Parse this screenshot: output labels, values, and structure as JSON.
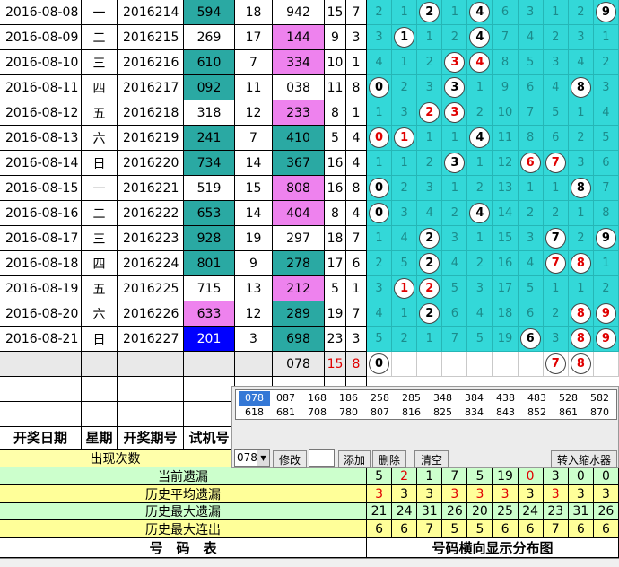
{
  "rows": [
    {
      "date": "2016-08-08",
      "week": "一",
      "issue": "2016214",
      "draw": "594",
      "draw_style": "teal",
      "sum": "18",
      "test": "942",
      "test_style": "white",
      "span": "15",
      "tail": "7",
      "dist": [
        "2",
        "1",
        "*2",
        "1",
        "*4",
        "6",
        "3",
        "1",
        "2",
        "*9"
      ]
    },
    {
      "date": "2016-08-09",
      "week": "二",
      "issue": "2016215",
      "draw": "269",
      "draw_style": "white",
      "sum": "17",
      "test": "144",
      "test_style": "pink",
      "span": "9",
      "tail": "3",
      "dist": [
        "3",
        "*1",
        "1",
        "2",
        "*4",
        "7",
        "4",
        "2",
        "3",
        "1"
      ]
    },
    {
      "date": "2016-08-10",
      "week": "三",
      "issue": "2016216",
      "draw": "610",
      "draw_style": "teal",
      "sum": "7",
      "test": "334",
      "test_style": "pink",
      "span": "10",
      "tail": "1",
      "dist": [
        "4",
        "1",
        "2",
        "r3",
        "r4",
        "8",
        "5",
        "3",
        "4",
        "2"
      ]
    },
    {
      "date": "2016-08-11",
      "week": "四",
      "issue": "2016217",
      "draw": "092",
      "draw_style": "teal",
      "sum": "11",
      "test": "038",
      "test_style": "white",
      "span": "11",
      "tail": "8",
      "dist": [
        "*0",
        "2",
        "3",
        "*3",
        "1",
        "9",
        "6",
        "4",
        "*8",
        "3"
      ]
    },
    {
      "date": "2016-08-12",
      "week": "五",
      "issue": "2016218",
      "draw": "318",
      "draw_style": "white",
      "sum": "12",
      "test": "233",
      "test_style": "pink",
      "span": "8",
      "tail": "1",
      "dist": [
        "1",
        "3",
        "r2",
        "r3",
        "2",
        "10",
        "7",
        "5",
        "1",
        "4"
      ]
    },
    {
      "date": "2016-08-13",
      "week": "六",
      "issue": "2016219",
      "draw": "241",
      "draw_style": "teal",
      "sum": "7",
      "test": "410",
      "test_style": "teal",
      "span": "5",
      "tail": "4",
      "dist": [
        "r0",
        "r1",
        "1",
        "1",
        "*4",
        "11",
        "8",
        "6",
        "2",
        "5"
      ]
    },
    {
      "date": "2016-08-14",
      "week": "日",
      "issue": "2016220",
      "draw": "734",
      "draw_style": "teal",
      "sum": "14",
      "test": "367",
      "test_style": "teal",
      "span": "16",
      "tail": "4",
      "dist": [
        "1",
        "1",
        "2",
        "*3",
        "1",
        "12",
        "r6",
        "r7",
        "3",
        "6"
      ]
    },
    {
      "date": "2016-08-15",
      "week": "一",
      "issue": "2016221",
      "draw": "519",
      "draw_style": "white",
      "sum": "15",
      "test": "808",
      "test_style": "pink",
      "span": "16",
      "tail": "8",
      "dist": [
        "*0",
        "2",
        "3",
        "1",
        "2",
        "13",
        "1",
        "1",
        "*8",
        "7"
      ]
    },
    {
      "date": "2016-08-16",
      "week": "二",
      "issue": "2016222",
      "draw": "653",
      "draw_style": "teal",
      "sum": "14",
      "test": "404",
      "test_style": "pink",
      "span": "8",
      "tail": "4",
      "dist": [
        "*0",
        "3",
        "4",
        "2",
        "*4",
        "14",
        "2",
        "2",
        "1",
        "8"
      ]
    },
    {
      "date": "2016-08-17",
      "week": "三",
      "issue": "2016223",
      "draw": "928",
      "draw_style": "teal",
      "sum": "19",
      "test": "297",
      "test_style": "white",
      "span": "18",
      "tail": "7",
      "dist": [
        "1",
        "4",
        "*2",
        "3",
        "1",
        "15",
        "3",
        "*7",
        "2",
        "*9"
      ]
    },
    {
      "date": "2016-08-18",
      "week": "四",
      "issue": "2016224",
      "draw": "801",
      "draw_style": "teal",
      "sum": "9",
      "test": "278",
      "test_style": "teal",
      "span": "17",
      "tail": "6",
      "dist": [
        "2",
        "5",
        "*2",
        "4",
        "2",
        "16",
        "4",
        "r7",
        "r8",
        "1"
      ]
    },
    {
      "date": "2016-08-19",
      "week": "五",
      "issue": "2016225",
      "draw": "715",
      "draw_style": "white",
      "sum": "13",
      "test": "212",
      "test_style": "pink",
      "span": "5",
      "tail": "1",
      "dist": [
        "3",
        "r1",
        "r2",
        "5",
        "3",
        "17",
        "5",
        "1",
        "1",
        "2"
      ]
    },
    {
      "date": "2016-08-20",
      "week": "六",
      "issue": "2016226",
      "draw": "633",
      "draw_style": "pink",
      "sum": "12",
      "test": "289",
      "test_style": "teal",
      "span": "19",
      "tail": "7",
      "dist": [
        "4",
        "1",
        "*2",
        "6",
        "4",
        "18",
        "6",
        "2",
        "r8",
        "r9"
      ]
    },
    {
      "date": "2016-08-21",
      "week": "日",
      "issue": "2016227",
      "draw": "201",
      "draw_style": "blue",
      "sum": "3",
      "test": "698",
      "test_style": "teal",
      "span": "23",
      "tail": "3",
      "dist": [
        "5",
        "2",
        "1",
        "7",
        "5",
        "19",
        "*6",
        "3",
        "r8",
        "r9"
      ]
    }
  ],
  "pending_row": {
    "test": "078",
    "span": "15",
    "tail": "8",
    "dist": [
      "*0",
      "",
      "",
      "",
      "",
      "",
      "",
      "r7",
      "r8",
      ""
    ]
  },
  "header": {
    "date": "开奖日期",
    "week": "星期",
    "issue": "开奖期号",
    "test": "试机号"
  },
  "combo_items": [
    "078",
    "087",
    "168",
    "186",
    "258",
    "285",
    "348",
    "384",
    "438",
    "483",
    "528",
    "582",
    "618",
    "681",
    "708",
    "780",
    "807",
    "816",
    "825",
    "834",
    "843",
    "852",
    "861",
    "870"
  ],
  "toolbar": {
    "select_value": "078",
    "modify": "修改",
    "add": "添加",
    "delete": "删除",
    "clear": "清空",
    "transfer": "转入缩水器"
  },
  "stats": {
    "occurrences_label": "出现次数",
    "current_miss_label": "当前遗漏",
    "current_miss": [
      "5",
      "2",
      "1",
      "7",
      "5",
      "19",
      "0",
      "3",
      "0",
      "0"
    ],
    "avg_miss_label": "历史平均遗漏",
    "avg_miss": [
      "3",
      "3",
      "3",
      "3",
      "3",
      "3",
      "3",
      "3",
      "3",
      "3"
    ],
    "max_miss_label": "历史最大遗漏",
    "max_miss": [
      "21",
      "24",
      "31",
      "26",
      "20",
      "25",
      "24",
      "23",
      "31",
      "26"
    ],
    "max_run_label": "历史最大连出",
    "max_run": [
      "6",
      "6",
      "7",
      "5",
      "5",
      "6",
      "6",
      "7",
      "6",
      "6"
    ]
  },
  "footer": {
    "left": "号　码　表",
    "right": "号码横向显示分布图"
  },
  "colors": {
    "teal": "#2aa9a3",
    "pink": "#ee82ee",
    "blue": "#0000ff",
    "cyan": "#33d8d8",
    "red": "#e00000"
  }
}
